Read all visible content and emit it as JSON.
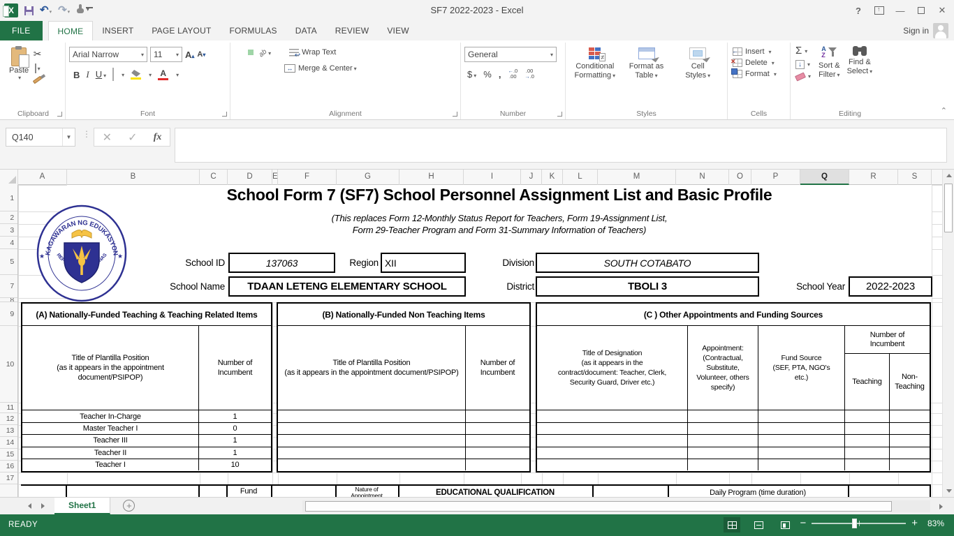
{
  "titlebar": {
    "title": "SF7 2022-2023 - Excel"
  },
  "tabs": {
    "file": "FILE",
    "items": [
      "HOME",
      "INSERT",
      "PAGE LAYOUT",
      "FORMULAS",
      "DATA",
      "REVIEW",
      "VIEW"
    ],
    "active": "HOME",
    "sign_in": "Sign in"
  },
  "ribbon": {
    "clipboard": {
      "paste": "Paste",
      "label": "Clipboard"
    },
    "font": {
      "name": "Arial Narrow",
      "size": "11",
      "bold": "B",
      "italic": "I",
      "underline": "U",
      "label": "Font"
    },
    "alignment": {
      "wrap": "Wrap Text",
      "merge": "Merge & Center",
      "orient": "ab",
      "label": "Alignment"
    },
    "number": {
      "format": "General",
      "dollar": "$",
      "percent": "%",
      "comma": ",",
      "label": "Number"
    },
    "styles": {
      "cf1": "Conditional",
      "cf2": "Formatting",
      "ft1": "Format as",
      "ft2": "Table",
      "cs1": "Cell",
      "cs2": "Styles",
      "label": "Styles"
    },
    "cells": {
      "insert": "Insert",
      "delete": "Delete",
      "format": "Format",
      "label": "Cells"
    },
    "editing": {
      "sigma": "Σ",
      "sort1": "Sort &",
      "sort2": "Filter",
      "find1": "Find &",
      "find2": "Select",
      "label": "Editing"
    }
  },
  "formula": {
    "name_box": "Q140",
    "fx": "fx",
    "value": ""
  },
  "grid": {
    "columns": [
      "A",
      "B",
      "C",
      "D",
      "E",
      "F",
      "G",
      "H",
      "I",
      "J",
      "K",
      "L",
      "M",
      "N",
      "O",
      "P",
      "Q",
      "R",
      "S"
    ],
    "selected_column": "Q",
    "rows": [
      "1",
      "2",
      "3",
      "4",
      "5",
      "7",
      "8",
      "9",
      "10",
      "11",
      "12",
      "13",
      "14",
      "15",
      "16",
      "17"
    ]
  },
  "sheet": {
    "title": "School Form 7 (SF7) School Personnel Assignment List and Basic Profile",
    "subtitle1": "(This replaces Form 12-Monthly Status Report for Teachers, Form 19-Assignment List,",
    "subtitle2": "Form 29-Teacher Program and Form 31-Summary Information of Teachers)",
    "logo": {
      "top_text": "KAGAWARAN NG EDUKASYON",
      "bottom_text": "REPUBLIKA NG PILIPINAS",
      "star": "★"
    },
    "fields": {
      "school_id_label": "School ID",
      "school_id": "137063",
      "region_label": "Region",
      "region": "XII",
      "division_label": "Division",
      "division": "SOUTH COTABATO",
      "school_name_label": "School Name",
      "school_name": "TDAAN LETENG ELEMENTARY SCHOOL",
      "district_label": "District",
      "district": "TBOLI 3",
      "school_year_label": "School Year",
      "school_year": "2022-2023"
    },
    "sections": {
      "a": {
        "header": "(A) Nationally-Funded Teaching & Teaching Related Items",
        "col1": "Title of Plantilla Position\n(as it appears  in the appointment document/PSIPOP)",
        "col2": "Number of Incumbent",
        "rows": [
          {
            "title": "Teacher In-Charge",
            "count": "1"
          },
          {
            "title": "Master Teacher I",
            "count": "0"
          },
          {
            "title": "Teacher III",
            "count": "1"
          },
          {
            "title": "Teacher II",
            "count": "1"
          },
          {
            "title": "Teacher I",
            "count": "10"
          }
        ]
      },
      "b": {
        "header": "(B) Nationally-Funded Non Teaching Items",
        "col1": "Title of Plantilla Position\n(as it appears  in the appointment document/PSIPOP)",
        "col2": "Number of Incumbent"
      },
      "c": {
        "header": "(C ) Other Appointments and Funding Sources",
        "col1": "Title of Designation\n(as it appears in the\ncontract/document: Teacher, Clerk,\nSecurity Guard, Driver etc.)",
        "col2": "Appointment:\n(Contractual,\nSubstitute,\nVolunteer,  others\nspecify)",
        "col3": "Fund Source\n(SEF, PTA, NGO's\netc.)",
        "col4": "Number of\nIncumbent",
        "col4a": "Teaching",
        "col4b": "Non-\nTeaching"
      }
    },
    "bottom_row": {
      "fund": "Fund",
      "nature": "Nature of\nAppointment",
      "educ": "EDUCATIONAL QUALIFICATION",
      "daily": "Daily Program (time duration)"
    }
  },
  "sheet_tabs": {
    "active": "Sheet1"
  },
  "status": {
    "mode": "READY",
    "zoom": "83%"
  }
}
